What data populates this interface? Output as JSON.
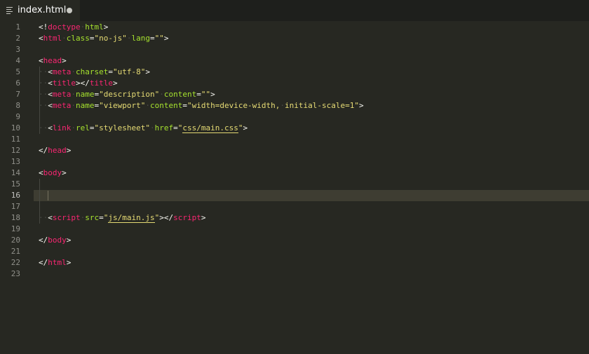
{
  "tab": {
    "filename": "index.html",
    "modified": true,
    "icon": "lines-icon"
  },
  "theme": {
    "background": "#272822",
    "tag": "#f92672",
    "attribute": "#a6e22e",
    "string": "#e6db74",
    "text": "#f8f8f2",
    "gutter": "#90908a"
  },
  "editor": {
    "current_line": 16,
    "line_numbers": [
      "1",
      "2",
      "3",
      "4",
      "5",
      "6",
      "7",
      "8",
      "9",
      "10",
      "11",
      "12",
      "13",
      "14",
      "15",
      "16",
      "17",
      "18",
      "19",
      "20",
      "21",
      "22",
      "23"
    ],
    "lines": [
      [
        [
          "punc",
          "<!"
        ],
        [
          "tag",
          "doctype"
        ],
        [
          "dot",
          "·"
        ],
        [
          "attr",
          "html"
        ],
        [
          "punc",
          ">"
        ]
      ],
      [
        [
          "punc",
          "<"
        ],
        [
          "tag",
          "html"
        ],
        [
          "dot",
          "·"
        ],
        [
          "attr",
          "class"
        ],
        [
          "punc",
          "="
        ],
        [
          "str",
          "\"no-js\""
        ],
        [
          "dot",
          "·"
        ],
        [
          "attr",
          "lang"
        ],
        [
          "punc",
          "="
        ],
        [
          "str",
          "\"\""
        ],
        [
          "punc",
          ">"
        ]
      ],
      [],
      [
        [
          "punc",
          "<"
        ],
        [
          "tag",
          "head"
        ],
        [
          "punc",
          ">"
        ]
      ],
      [
        [
          "dot",
          "··"
        ],
        [
          "punc",
          "<"
        ],
        [
          "tag",
          "meta"
        ],
        [
          "dot",
          "·"
        ],
        [
          "attr",
          "charset"
        ],
        [
          "punc",
          "="
        ],
        [
          "str",
          "\"utf-8\""
        ],
        [
          "punc",
          ">"
        ]
      ],
      [
        [
          "dot",
          "··"
        ],
        [
          "punc",
          "<"
        ],
        [
          "tag",
          "title"
        ],
        [
          "punc",
          "></"
        ],
        [
          "tag",
          "title"
        ],
        [
          "punc",
          ">"
        ]
      ],
      [
        [
          "dot",
          "··"
        ],
        [
          "punc",
          "<"
        ],
        [
          "tag",
          "meta"
        ],
        [
          "dot",
          "·"
        ],
        [
          "attr",
          "name"
        ],
        [
          "punc",
          "="
        ],
        [
          "str",
          "\"description\""
        ],
        [
          "dot",
          "·"
        ],
        [
          "attr",
          "content"
        ],
        [
          "punc",
          "="
        ],
        [
          "str",
          "\"\""
        ],
        [
          "punc",
          ">"
        ]
      ],
      [
        [
          "dot",
          "··"
        ],
        [
          "punc",
          "<"
        ],
        [
          "tag",
          "meta"
        ],
        [
          "dot",
          "·"
        ],
        [
          "attr",
          "name"
        ],
        [
          "punc",
          "="
        ],
        [
          "str",
          "\"viewport\""
        ],
        [
          "dot",
          "·"
        ],
        [
          "attr",
          "content"
        ],
        [
          "punc",
          "="
        ],
        [
          "str",
          "\"width=device-width,"
        ],
        [
          "dot",
          "·"
        ],
        [
          "str",
          "initial-scale=1\""
        ],
        [
          "punc",
          ">"
        ]
      ],
      [],
      [
        [
          "dot",
          "··"
        ],
        [
          "punc",
          "<"
        ],
        [
          "tag",
          "link"
        ],
        [
          "dot",
          "·"
        ],
        [
          "attr",
          "rel"
        ],
        [
          "punc",
          "="
        ],
        [
          "str",
          "\"stylesheet\""
        ],
        [
          "dot",
          "·"
        ],
        [
          "attr",
          "href"
        ],
        [
          "punc",
          "="
        ],
        [
          "str",
          "\""
        ],
        [
          "link",
          "css/main.css"
        ],
        [
          "str",
          "\""
        ],
        [
          "punc",
          ">"
        ]
      ],
      [],
      [
        [
          "punc",
          "</"
        ],
        [
          "tag",
          "head"
        ],
        [
          "punc",
          ">"
        ]
      ],
      [],
      [
        [
          "punc",
          "<"
        ],
        [
          "tag",
          "body"
        ],
        [
          "punc",
          ">"
        ]
      ],
      [],
      [],
      [],
      [
        [
          "dot",
          "··"
        ],
        [
          "punc",
          "<"
        ],
        [
          "tag",
          "script"
        ],
        [
          "dot",
          "·"
        ],
        [
          "attr",
          "src"
        ],
        [
          "punc",
          "="
        ],
        [
          "str",
          "\""
        ],
        [
          "link",
          "js/main.js"
        ],
        [
          "str",
          "\""
        ],
        [
          "punc",
          "></"
        ],
        [
          "tag",
          "script"
        ],
        [
          "punc",
          ">"
        ]
      ],
      [],
      [
        [
          "punc",
          "</"
        ],
        [
          "tag",
          "body"
        ],
        [
          "punc",
          ">"
        ]
      ],
      [],
      [
        [
          "punc",
          "</"
        ],
        [
          "tag",
          "html"
        ],
        [
          "punc",
          ">"
        ]
      ],
      []
    ]
  }
}
